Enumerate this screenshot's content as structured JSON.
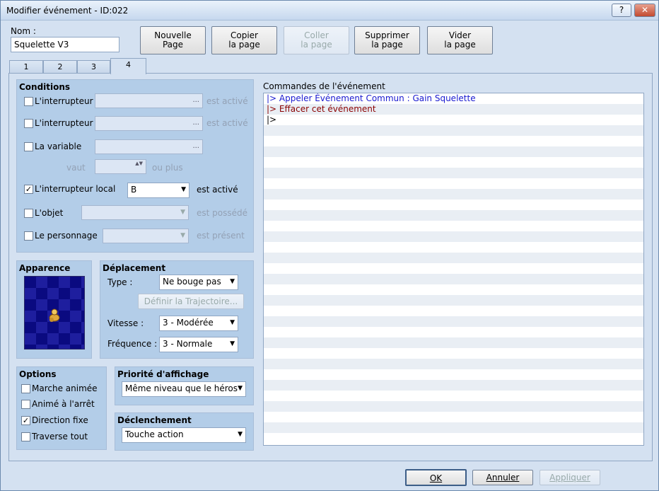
{
  "window": {
    "title": "Modifier événement - ID:022",
    "help": "?",
    "close": "✕"
  },
  "name": {
    "label": "Nom :",
    "value": "Squelette V3"
  },
  "toolbar": {
    "new_page": [
      "Nouvelle",
      "Page"
    ],
    "copy_page": [
      "Copier",
      "la page"
    ],
    "paste_page": [
      "Coller",
      "la page"
    ],
    "delete_page": [
      "Supprimer",
      "la page"
    ],
    "clear_page": [
      "Vider",
      "la page"
    ]
  },
  "tabs": [
    "1",
    "2",
    "3",
    "4"
  ],
  "conditions": {
    "title": "Conditions",
    "switch1": {
      "label": "L'interrupteur",
      "value": "...",
      "suffix": "est activé",
      "checked": false
    },
    "switch2": {
      "label": "L'interrupteur",
      "value": "...",
      "suffix": "est activé",
      "checked": false
    },
    "variable": {
      "label": "La variable",
      "value": "...",
      "checked": false
    },
    "variable_value": {
      "prefix": "vaut",
      "suffix": "ou plus"
    },
    "self_switch": {
      "label": "L'interrupteur local",
      "value": "B",
      "suffix": "est activé",
      "checked": true
    },
    "item": {
      "label": "L'objet",
      "value": "",
      "suffix": "est possédé",
      "checked": false
    },
    "actor": {
      "label": "Le personnage",
      "value": "",
      "suffix": "est présent",
      "checked": false
    }
  },
  "appearance": {
    "title": "Apparence"
  },
  "movement": {
    "title": "Déplacement",
    "type_label": "Type :",
    "type_value": "Ne bouge pas",
    "route_button": "Définir la Trajectoire...",
    "speed_label": "Vitesse :",
    "speed_value": "3 - Modérée",
    "freq_label": "Fréquence :",
    "freq_value": "3 - Normale"
  },
  "options": {
    "title": "Options",
    "items": [
      {
        "label": "Marche animée",
        "checked": false
      },
      {
        "label": "Animé à l'arrêt",
        "checked": false
      },
      {
        "label": "Direction fixe",
        "checked": true
      },
      {
        "label": "Traverse tout",
        "checked": false
      }
    ]
  },
  "priority": {
    "title": "Priorité d'affichage",
    "value": "Même niveau que le héros"
  },
  "trigger": {
    "title": "Déclenchement",
    "value": "Touche action"
  },
  "commands": {
    "title": "Commandes de l'événement",
    "lines": [
      {
        "text": "|> Appeler Événement Commun : Gain Squelette",
        "color": "#1a1ad0"
      },
      {
        "text": "|> Effacer cet événement",
        "color": "#8a0000"
      },
      {
        "text": "|>",
        "color": "#000000"
      }
    ]
  },
  "footer": {
    "ok": "OK",
    "cancel": "Annuler",
    "apply": "Appliquer"
  },
  "check_mark": "✓",
  "arrow": "▼",
  "spin": "▲▼"
}
